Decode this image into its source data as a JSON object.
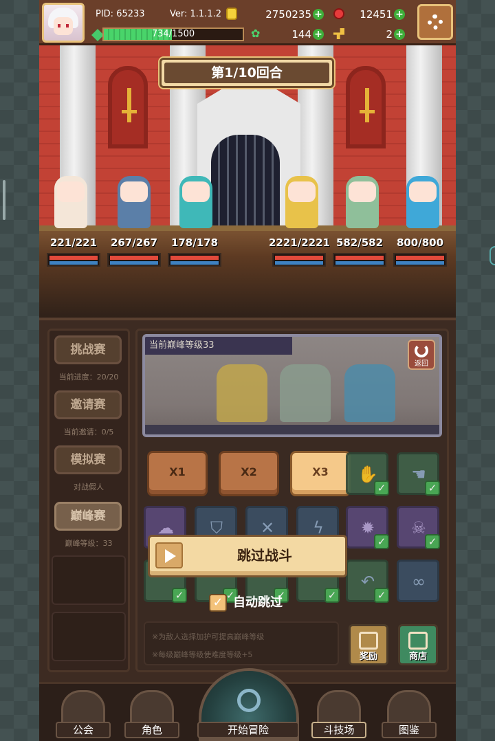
{
  "topbar": {
    "pid": "PID: 65233",
    "version": "Ver: 1.1.1.2",
    "gold": "2750235",
    "gems": "12451",
    "exp_text": "734/1500",
    "exp_fraction": 0.489,
    "clover": "144",
    "keys": "2"
  },
  "battle": {
    "round": "第1/10回合",
    "allies": [
      {
        "hp": "221/221"
      },
      {
        "hp": "267/267"
      },
      {
        "hp": "178/178"
      }
    ],
    "enemies": [
      {
        "hp": "2221/2221"
      },
      {
        "hp": "582/582"
      },
      {
        "hp": "800/800"
      }
    ]
  },
  "sidebar": {
    "challenge": {
      "label": "挑战赛",
      "sub": "当前进度：20/20"
    },
    "invite": {
      "label": "邀请赛",
      "sub": "当前邀请：0/5"
    },
    "simulate": {
      "label": "模拟赛",
      "sub": "对战假人"
    },
    "peak": {
      "label": "巅峰赛",
      "sub": "巅峰等级：33"
    }
  },
  "preview": {
    "peak_level": "当前巅峰等级33",
    "back_label": "返回"
  },
  "speed": {
    "x1": "X1",
    "x2": "X2",
    "x3": "X3"
  },
  "skip": {
    "label": "跳过战斗",
    "auto_label": "自动跳过",
    "auto_checked": true
  },
  "info": {
    "line1": "※为敌人选择加护可提高巅峰等级",
    "line2": "※每级巅峰等级使难度等级+5"
  },
  "buttons": {
    "reward": "奖励",
    "shop": "商店"
  },
  "nav": {
    "guild": "公会",
    "character": "角色",
    "adventure": "开始冒险",
    "arena": "斗技场",
    "codex": "图鉴"
  },
  "colors": {
    "accent_gold": "#e8c27a",
    "exp_green": "#49d46a",
    "hp_red": "#e24a3b",
    "mp_blue": "#3e82c2"
  }
}
